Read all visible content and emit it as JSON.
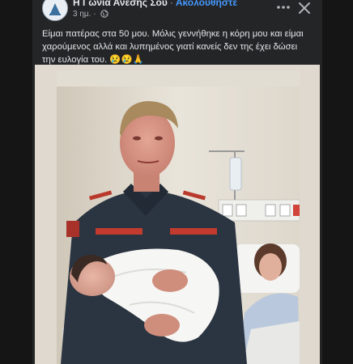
{
  "post": {
    "page_name": "Η Γωνία Ανεσης Σου",
    "separator": "·",
    "follow_label": "Ακολουθήστε",
    "time": "3 ημ.",
    "time_separator": "·",
    "privacy_icon": "globe-icon",
    "more_icon": "more-options-icon",
    "close_icon": "close-icon",
    "caption": "Είμαι πατέρας στα 50 μου. Μόλις γεννήθηκε η κόρη μου και είμαι χαρούμενος αλλά και λυπημένος γιατί κανείς δεν της έχει δώσει την ευλογία του. 😢😢🙏"
  },
  "colors": {
    "post_background": "#242526",
    "text_primary": "#e4e6eb",
    "text_secondary": "#b0b3b8",
    "link": "#4599ff"
  }
}
